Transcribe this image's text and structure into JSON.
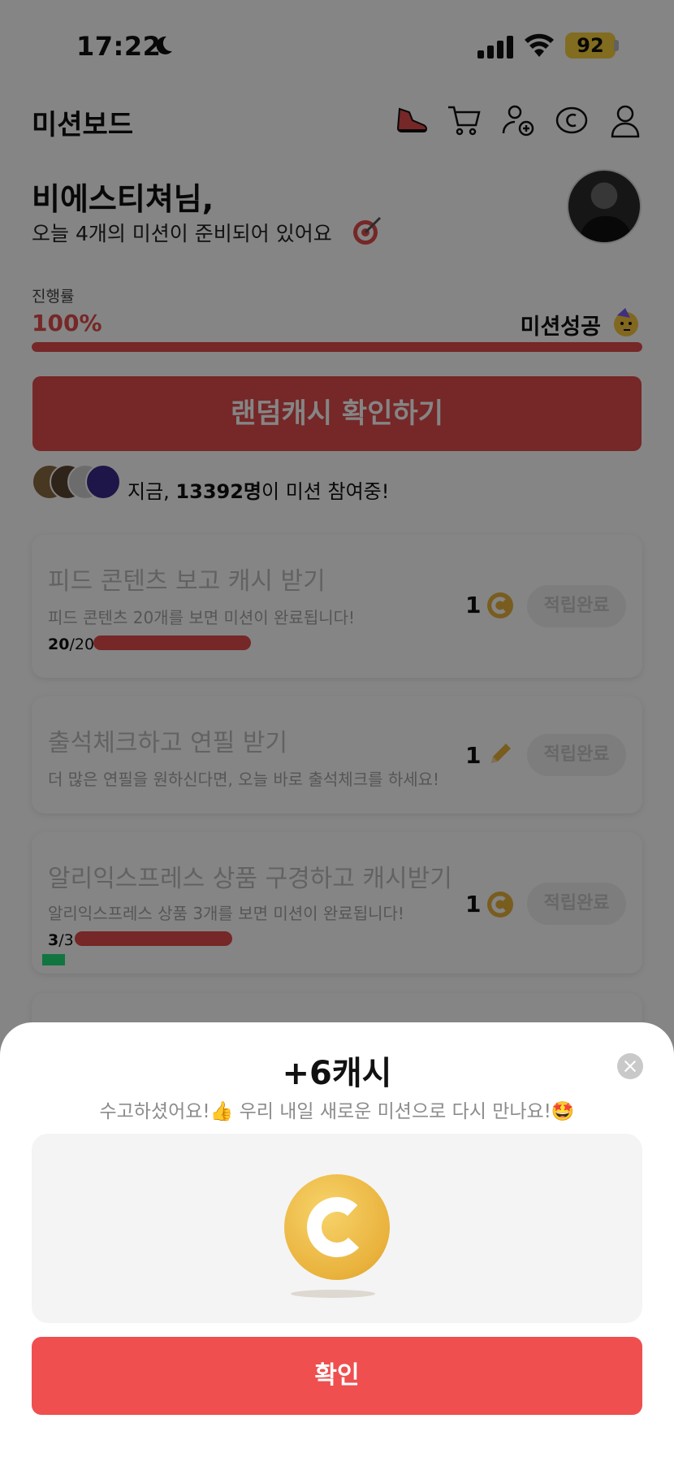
{
  "status_bar": {
    "time": "17:22",
    "battery": "92"
  },
  "header": {
    "title": "미션보드"
  },
  "greeting": {
    "name": "비에스티쳐님,",
    "subtitle": "오늘 4개의 미션이 준비되어 있어요"
  },
  "progress": {
    "label": "진행률",
    "percent_text": "100%",
    "percent_value": 1.0,
    "status": "미션성공"
  },
  "random_cash_button": "랜덤캐시 확인하기",
  "participants": {
    "prefix": "지금, ",
    "count": "13392명",
    "suffix": "이 미션 참여중!"
  },
  "missions": [
    {
      "title": "피드 콘텐츠 보고 캐시 받기",
      "desc": "피드 콘텐츠 20개를 보면 미션이 완료됩니다!",
      "reward": "1",
      "reward_icon": "coin-icon",
      "button": "적립완료",
      "progress_done": "20",
      "progress_total": "/20",
      "progress_value": 1.0
    },
    {
      "title": "출석체크하고 연필 받기",
      "desc": "더 많은 연필을 원하신다면, 오늘 바로 출석체크를 하세요!",
      "reward": "1",
      "reward_icon": "pencil-icon",
      "button": "적립완료"
    },
    {
      "title": "알리익스프레스 상품 구경하고 캐시받기",
      "desc": "알리익스프레스 상품 3개를 보면 미션이 완료됩니다!",
      "reward": "1",
      "reward_icon": "coin-icon",
      "button": "적립완료",
      "progress_done": "3",
      "progress_total": "/3",
      "progress_value": 1.0
    }
  ],
  "sheet": {
    "title": "+6캐시",
    "subtitle": "수고하셨어요!👍 우리 내일 새로운 미션으로 다시 만나요!🤩",
    "confirm": "확인"
  },
  "colors": {
    "accent": "#e24b4b",
    "confirm": "#ef4f4f",
    "battery": "#f7cf3c"
  }
}
